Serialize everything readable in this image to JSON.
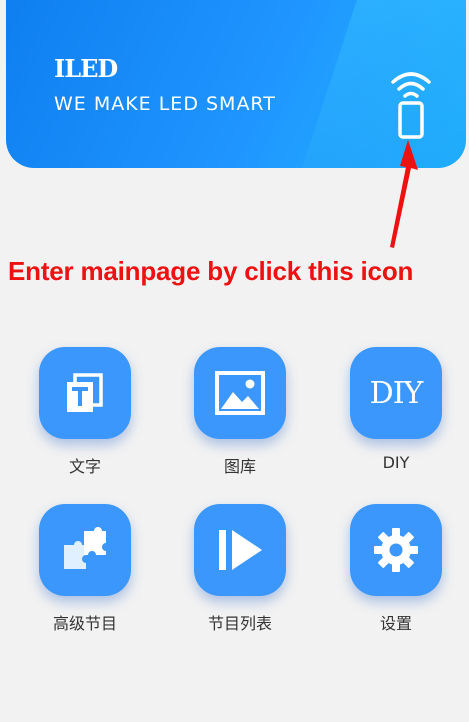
{
  "header": {
    "brand": "ILED",
    "slogan": "WE MAKE LED SMART"
  },
  "annotation": {
    "text": "Enter mainpage by click this icon",
    "color": "#ee1111"
  },
  "colors": {
    "header_start": "#0f7ff0",
    "header_end": "#22b6ff",
    "tile": "#3b97fb"
  },
  "tiles": [
    {
      "label": "文字",
      "icon": "text-icon"
    },
    {
      "label": "图库",
      "icon": "gallery-icon"
    },
    {
      "label": "DIY",
      "icon": "diy-icon",
      "icon_text": "DIY"
    },
    {
      "label": "高级节目",
      "icon": "puzzle-icon"
    },
    {
      "label": "节目列表",
      "icon": "play-icon"
    },
    {
      "label": "设置",
      "icon": "gear-icon"
    }
  ]
}
